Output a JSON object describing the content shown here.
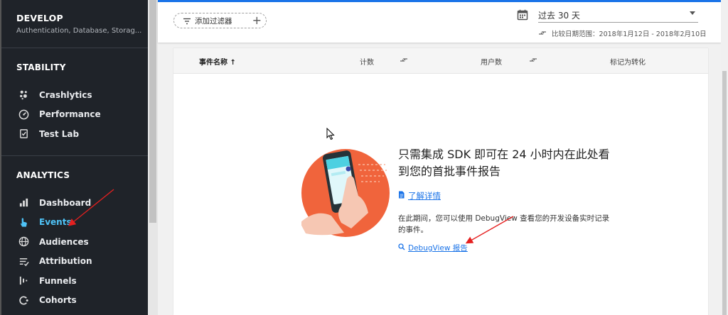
{
  "sidebar": {
    "header": {
      "title": "DEVELOP",
      "subtitle": "Authentication, Database, Storag..."
    },
    "stability": {
      "title": "STABILITY",
      "items": [
        {
          "label": "Crashlytics",
          "icon": "crashlytics-icon"
        },
        {
          "label": "Performance",
          "icon": "performance-icon"
        },
        {
          "label": "Test Lab",
          "icon": "test-lab-icon"
        }
      ]
    },
    "analytics": {
      "title": "ANALYTICS",
      "items": [
        {
          "label": "Dashboard",
          "icon": "dashboard-icon"
        },
        {
          "label": "Events",
          "icon": "events-icon",
          "active": true
        },
        {
          "label": "Audiences",
          "icon": "audiences-icon"
        },
        {
          "label": "Attribution",
          "icon": "attribution-icon"
        },
        {
          "label": "Funnels",
          "icon": "funnels-icon"
        },
        {
          "label": "Cohorts",
          "icon": "cohorts-icon"
        }
      ]
    }
  },
  "toolbar": {
    "filter_label": "添加过滤器",
    "date_range": "过去 30 天",
    "compare_label": "比较日期范围：2018年1月12日 - 2018年2月10日"
  },
  "table": {
    "columns": [
      "事件名称 ↑",
      "计数",
      "用户数",
      "标记为转化"
    ]
  },
  "empty_state": {
    "title": "只需集成 SDK 即可在 24 小时内在此处看到您的首批事件报告",
    "learn_more": "了解详情",
    "body": "在此期间，您可以使用 DebugView 查看您的开发设备实时记录的事件。",
    "debugview_link": "DebugView 报告"
  },
  "colors": {
    "sidebar_bg": "#1f2329",
    "active": "#4fc3f7",
    "link": "#1a73e8",
    "accent_orange": "#f0643c",
    "annotation_red": "#e52020"
  }
}
